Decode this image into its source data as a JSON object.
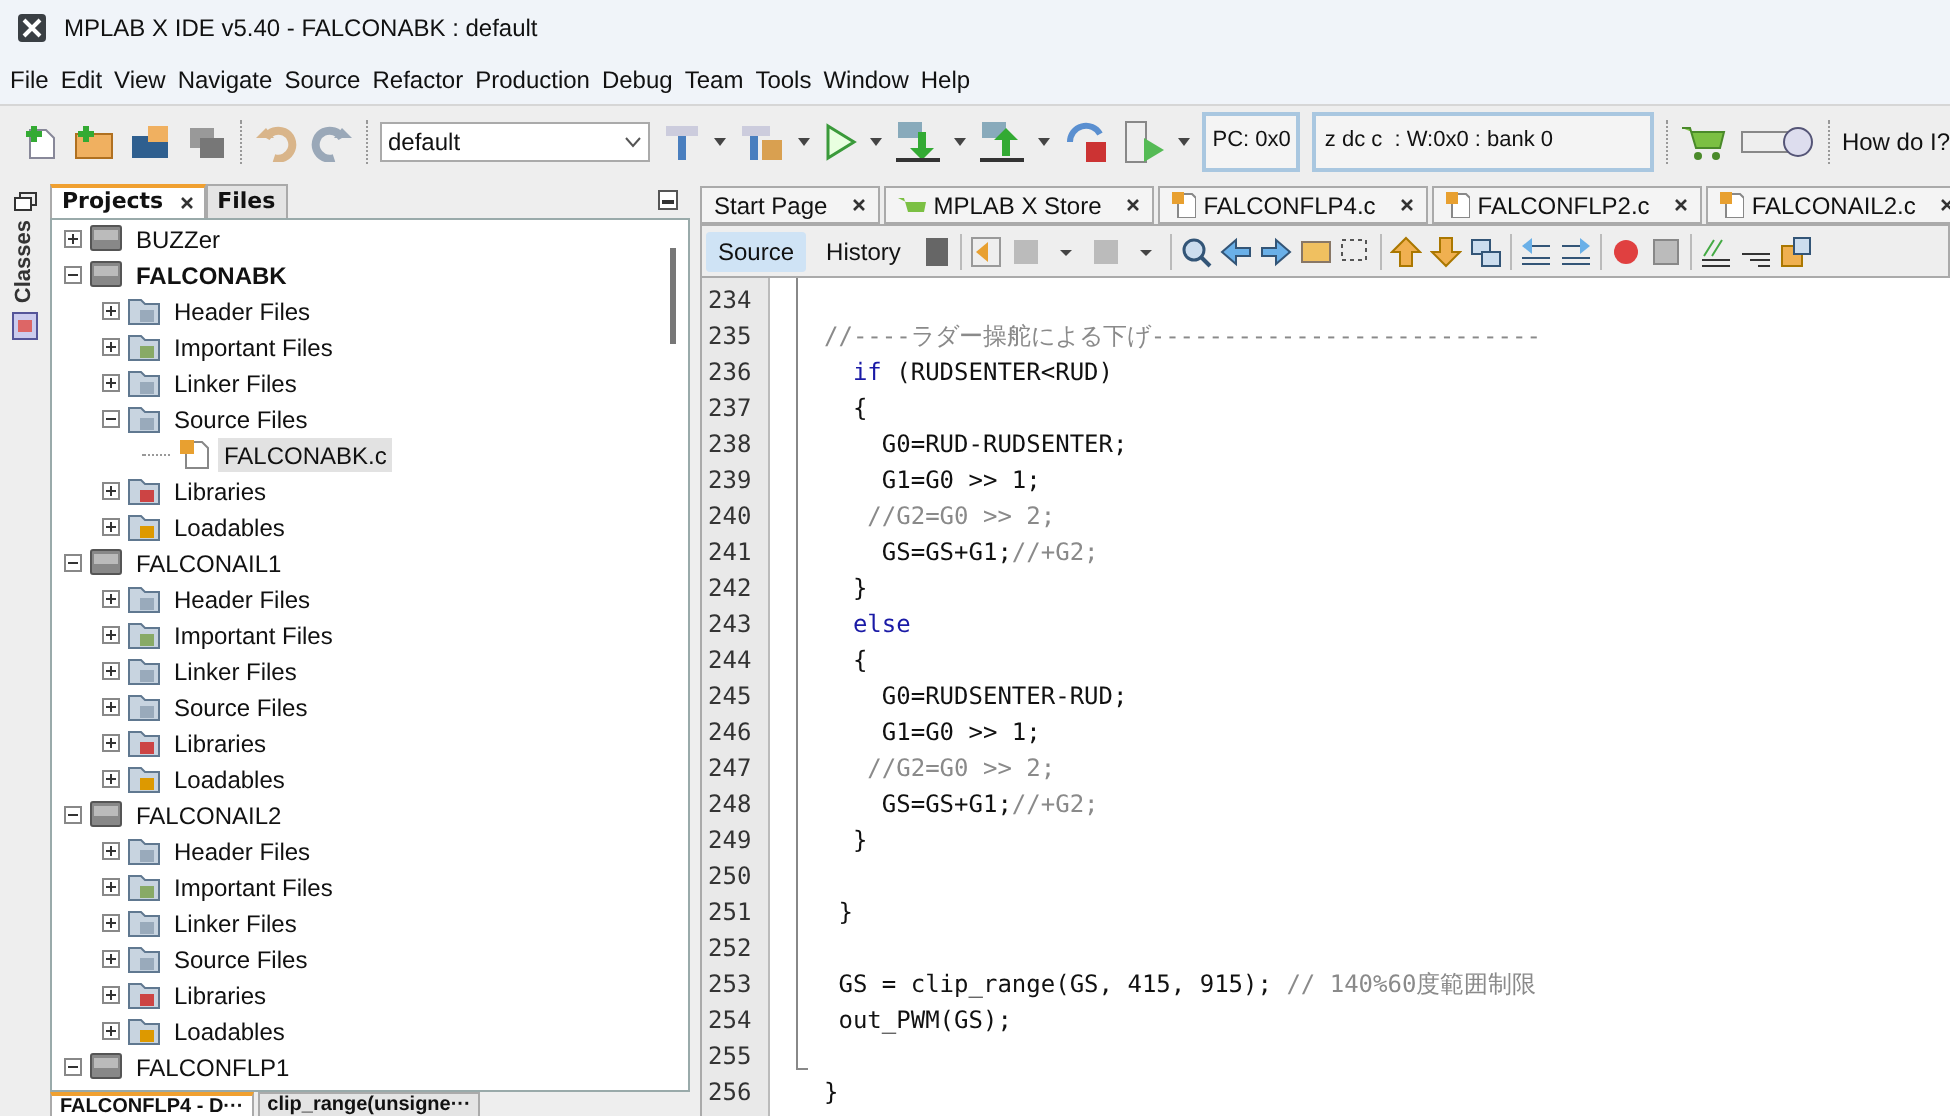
{
  "window": {
    "title": "MPLAB X IDE v5.40 - FALCONABK : default"
  },
  "menu": [
    "File",
    "Edit",
    "View",
    "Navigate",
    "Source",
    "Refactor",
    "Production",
    "Debug",
    "Team",
    "Tools",
    "Window",
    "Help"
  ],
  "toolbar": {
    "configuration": "default",
    "pc": "PC: 0x0",
    "status": "z dc c  : W:0x0 : bank 0",
    "help": "How do I?"
  },
  "side_rail": {
    "label": "Classes"
  },
  "project_tabs": [
    {
      "label": "Projects",
      "selected": true,
      "closable": true
    },
    {
      "label": "Files",
      "selected": false,
      "closable": false
    }
  ],
  "tree": [
    {
      "kind": "project",
      "label": "BUZZer",
      "main": false,
      "expanded": false,
      "selected": false
    },
    {
      "kind": "project",
      "label": "FALCONABK",
      "main": true,
      "expanded": true,
      "selected": false,
      "children": [
        {
          "kind": "header",
          "label": "Header Files",
          "expanded": false,
          "selected": false
        },
        {
          "kind": "important",
          "label": "Important Files",
          "expanded": false,
          "selected": false
        },
        {
          "kind": "linker",
          "label": "Linker Files",
          "expanded": false,
          "selected": false
        },
        {
          "kind": "source",
          "label": "Source Files",
          "expanded": true,
          "selected": false,
          "children": [
            {
              "kind": "cfile",
              "label": "FALCONABK.c",
              "selected": true
            }
          ]
        },
        {
          "kind": "libraries",
          "label": "Libraries",
          "expanded": false,
          "selected": false
        },
        {
          "kind": "loadables",
          "label": "Loadables",
          "expanded": false,
          "selected": false
        }
      ]
    },
    {
      "kind": "project",
      "label": "FALCONAIL1",
      "main": false,
      "expanded": true,
      "selected": false,
      "children": [
        {
          "kind": "header",
          "label": "Header Files",
          "expanded": false,
          "selected": false
        },
        {
          "kind": "important",
          "label": "Important Files",
          "expanded": false,
          "selected": false
        },
        {
          "kind": "linker",
          "label": "Linker Files",
          "expanded": false,
          "selected": false
        },
        {
          "kind": "source",
          "label": "Source Files",
          "expanded": false,
          "selected": false
        },
        {
          "kind": "libraries",
          "label": "Libraries",
          "expanded": false,
          "selected": false
        },
        {
          "kind": "loadables",
          "label": "Loadables",
          "expanded": false,
          "selected": false
        }
      ]
    },
    {
      "kind": "project",
      "label": "FALCONAIL2",
      "main": false,
      "expanded": true,
      "selected": false,
      "children": [
        {
          "kind": "header",
          "label": "Header Files",
          "expanded": false,
          "selected": false
        },
        {
          "kind": "important",
          "label": "Important Files",
          "expanded": false,
          "selected": false
        },
        {
          "kind": "linker",
          "label": "Linker Files",
          "expanded": false,
          "selected": false
        },
        {
          "kind": "source",
          "label": "Source Files",
          "expanded": false,
          "selected": false
        },
        {
          "kind": "libraries",
          "label": "Libraries",
          "expanded": false,
          "selected": false
        },
        {
          "kind": "loadables",
          "label": "Loadables",
          "expanded": false,
          "selected": false
        }
      ]
    },
    {
      "kind": "project",
      "label": "FALCONFLP1",
      "main": false,
      "expanded": true,
      "selected": false
    }
  ],
  "bottom_tabs": [
    {
      "label": "FALCONFLP4 - D···",
      "selected": true
    },
    {
      "label": "clip_range(unsigne···",
      "selected": false
    }
  ],
  "editor_tabs": [
    {
      "label": "Start Page",
      "kind": "page"
    },
    {
      "label": "MPLAB X Store",
      "kind": "store"
    },
    {
      "label": "FALCONFLP4.c",
      "kind": "file"
    },
    {
      "label": "FALCONFLP2.c",
      "kind": "file"
    },
    {
      "label": "FALCONAIL2.c",
      "kind": "file"
    }
  ],
  "view_tabs": [
    {
      "label": "Source",
      "selected": true
    },
    {
      "label": "History",
      "selected": false
    }
  ],
  "code": [
    {
      "number": "234"
    },
    {
      "number": "235",
      "segments": [
        {
          "kind": "comment",
          "text": "//----ラダー操舵による下げ---------------------------"
        }
      ]
    },
    {
      "number": "236",
      "segments": [
        {
          "kind": "keyword",
          "text": "  if"
        },
        {
          "kind": "code",
          "text": " (RUDSENTER<RUD)"
        }
      ]
    },
    {
      "number": "237",
      "segments": [
        {
          "kind": "code",
          "text": "  {"
        }
      ]
    },
    {
      "number": "238",
      "segments": [
        {
          "kind": "code",
          "text": "    G0=RUD-RUDSENTER;"
        }
      ]
    },
    {
      "number": "239",
      "segments": [
        {
          "kind": "code",
          "text": "    G1=G0 >> 1;"
        }
      ]
    },
    {
      "number": "240",
      "segments": [
        {
          "kind": "comment",
          "text": "   //G2=G0 >> 2;"
        }
      ]
    },
    {
      "number": "241",
      "segments": [
        {
          "kind": "code",
          "text": "    GS=GS+G1;"
        },
        {
          "kind": "comment",
          "text": "//+G2;"
        }
      ]
    },
    {
      "number": "242",
      "segments": [
        {
          "kind": "code",
          "text": "  }"
        }
      ]
    },
    {
      "number": "243",
      "segments": [
        {
          "kind": "keyword",
          "text": "  else"
        }
      ]
    },
    {
      "number": "244",
      "segments": [
        {
          "kind": "code",
          "text": "  {"
        }
      ]
    },
    {
      "number": "245",
      "segments": [
        {
          "kind": "code",
          "text": "    G0=RUDSENTER-RUD;"
        }
      ]
    },
    {
      "number": "246",
      "segments": [
        {
          "kind": "code",
          "text": "    G1=G0 >> 1;"
        }
      ]
    },
    {
      "number": "247",
      "segments": [
        {
          "kind": "comment",
          "text": "   //G2=G0 >> 2;"
        }
      ]
    },
    {
      "number": "248",
      "segments": [
        {
          "kind": "code",
          "text": "    GS=GS+G1;"
        },
        {
          "kind": "comment",
          "text": "//+G2;"
        }
      ]
    },
    {
      "number": "249",
      "segments": [
        {
          "kind": "code",
          "text": "  }"
        }
      ]
    },
    {
      "number": "250"
    },
    {
      "number": "251",
      "segments": [
        {
          "kind": "code",
          "text": " }"
        }
      ]
    },
    {
      "number": "252"
    },
    {
      "number": "253",
      "segments": [
        {
          "kind": "code",
          "text": " GS = clip_range(GS, 415, 915); "
        },
        {
          "kind": "comment",
          "text": "// 140%60度範囲制限"
        }
      ]
    },
    {
      "number": "254",
      "segments": [
        {
          "kind": "code",
          "text": " out_PWM(GS);"
        }
      ]
    },
    {
      "number": "255"
    },
    {
      "number": "256",
      "segments": [
        {
          "kind": "code",
          "text": "}"
        }
      ]
    }
  ]
}
